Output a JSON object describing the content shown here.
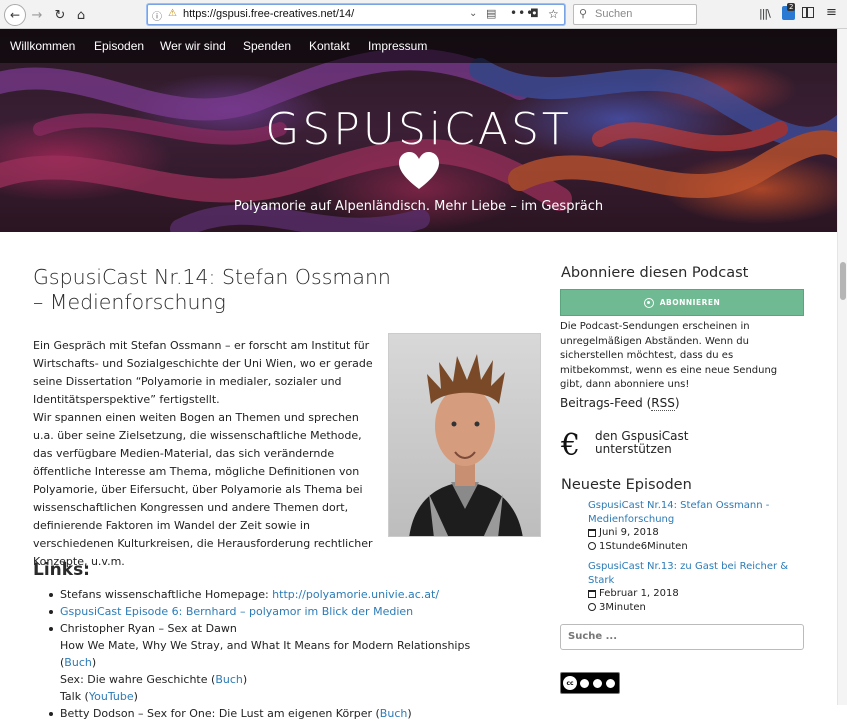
{
  "browser": {
    "url": "https://gspusi.free-creatives.net/14/",
    "search_placeholder": "Suchen",
    "notification_count": "2"
  },
  "nav": {
    "items": [
      "Willkommen",
      "Episoden",
      "Wer wir sind",
      "Spenden",
      "Kontakt",
      "Impressum"
    ]
  },
  "site": {
    "title": "GSPUSiCAST",
    "tagline": "Polyamorie auf Alpenländisch. Mehr Liebe – im Gespräch"
  },
  "post": {
    "title": "GspusiCast Nr.14: Stefan Ossmann – Medienforschung",
    "paragraph1": "Ein Gespräch mit Stefan Ossmann – er forscht am Institut für Wirtschafts- und Sozialgeschichte der Uni Wien, wo er gerade seine Dissertation  “Polyamorie in medialer, sozialer und Identitätsperspektive” fertigstellt.",
    "paragraph2": "Wir spannen einen weiten Bogen an Themen und sprechen u.a. über seine Zielsetzung, die wissenschaftliche Methode, das verfügbare Medien-Material, das sich verändernde öffentliche Interesse am Thema, mögliche Definitionen von Polyamorie, über Eifersucht, über Polyamorie als Thema bei wissenschaftlichen Kongressen und andere Themen dort, definierende Faktoren im Wandel der Zeit sowie in verschiedenen Kulturkreisen, die Herausforderung rechtlicher Konzepte, u.v.m.",
    "links_heading": "Links:",
    "links": {
      "homepage_label": "Stefans wissenschaftliche Homepage: ",
      "homepage_url": "http://polyamorie.univie.ac.at/",
      "episode6": "GspusiCast Episode 6: Bernhard – polyamor im Blick der Medien",
      "ryan_title": "Christopher Ryan – Sex at Dawn",
      "ryan_line2": "How We Mate, Why We Stray, and What It Means for Modern Relationships (",
      "ryan_line2_link": "Buch",
      "ryan_line3": "Sex: Die wahre Geschichte (",
      "ryan_line3_link": "Buch",
      "ryan_line4": "Talk (",
      "ryan_line4_link": "YouTube",
      "close_paren": ")",
      "dodson": "Betty Dodson – Sex for One: Die Lust am eigenen Körper (",
      "dodson_link": "Buch"
    }
  },
  "sidebar": {
    "subscribe_title": "Abonniere diesen Podcast",
    "subscribe_button": "ABONNIEREN",
    "subscribe_text": "Die Podcast-Sendungen erscheinen in unregelmäßigen Abständen. Wenn du sicherstellen möchtest, dass du es mitbekommst, wenn es eine neue Sendung gibt, dann abonniere uns!",
    "feed_label": "Beitrags-Feed (",
    "feed_link": "RSS",
    "feed_close": ")",
    "euro_symbol": "€",
    "support_text": "den GspusiCast unterstützen",
    "recent_title": "Neueste Episoden",
    "episodes": [
      {
        "title": "GspusiCast Nr.14: Stefan Ossmann - Medienforschung",
        "date": "Juni 9, 2018",
        "duration": "1Stunde6Minuten"
      },
      {
        "title": "GspusiCast Nr.13: zu Gast bei Reicher & Stark",
        "date": "Februar 1, 2018",
        "duration": "3Minuten"
      }
    ],
    "search_placeholder": "Suche ...",
    "license_badge": "cc",
    "license_labels": [
      "BY",
      "NC",
      "ND"
    ]
  },
  "colors": {
    "subscribe_green": "#6fba92",
    "link_blue": "#2c7bb6"
  }
}
